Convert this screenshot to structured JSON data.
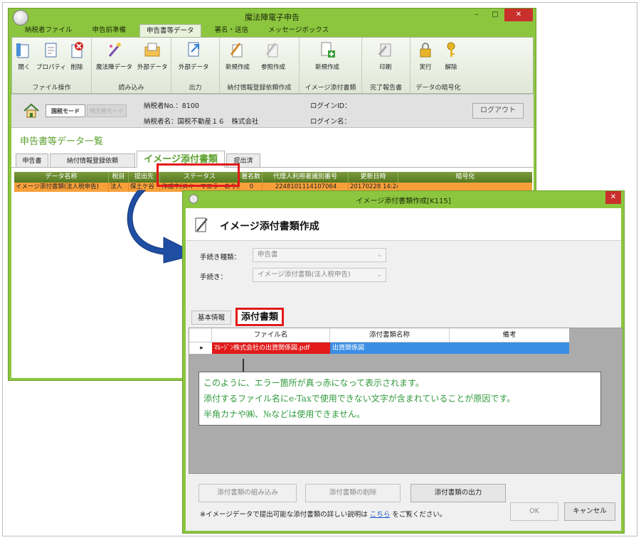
{
  "main_window": {
    "title": "魔法陣電子申告",
    "controls": {
      "minimize": "–",
      "maximize": "□",
      "close": "✕"
    },
    "ribbon_tabs": [
      {
        "label": "納税者ファイル"
      },
      {
        "label": "申告前準備"
      },
      {
        "label": "申告書等データ",
        "active": true
      },
      {
        "label": "署名・送信"
      },
      {
        "label": "メッセージボックス"
      }
    ],
    "ribbon_groups": [
      {
        "label": "ファイル操作",
        "buttons": [
          "開く",
          "プロパティ",
          "削除"
        ]
      },
      {
        "label": "読み込み",
        "buttons": [
          "魔法陣データ",
          "外部データ"
        ]
      },
      {
        "label": "出力",
        "buttons": [
          "外部データ"
        ]
      },
      {
        "label": "納付情報登録依頼作成",
        "buttons": [
          "新規作成",
          "参照作成"
        ]
      },
      {
        "label": "イメージ添付書類",
        "buttons": [
          "新規作成"
        ]
      },
      {
        "label": "完了報告書",
        "buttons": [
          "印刷"
        ]
      },
      {
        "label": "データの暗号化",
        "buttons": [
          "実行",
          "解除"
        ]
      }
    ],
    "mode": {
      "national": "国税モード",
      "local": "地方税モード",
      "taxpayer_no": "納税者No.：8100",
      "taxpayer_name": "納税者名：国税不動産１６　株式会社",
      "login_id": "ログインID：",
      "login_name": "ログイン名：",
      "logout": "ログアウト"
    },
    "section_title": "申告書等データ一覧",
    "tabs": [
      {
        "label": "申告書"
      },
      {
        "label": "納付情報登録依頼"
      },
      {
        "label": "イメージ添付書類",
        "active": true
      },
      {
        "label": "提出済"
      }
    ],
    "grid": {
      "columns": [
        "データ名称",
        "税目",
        "提出先",
        "ステータス",
        "署名数",
        "代理人利用者識別番号",
        "更新日時",
        "暗号化"
      ],
      "rows": [
        [
          "イメージ添付書類(法人税申告)",
          "法人",
          "保土ケ谷",
          "作成中(スキーマエラーあり)",
          "0",
          "2248101114107064",
          "20170228 14:24",
          ""
        ]
      ]
    }
  },
  "dialog": {
    "title": "イメージ添付書類作成[K115]",
    "close": "✕",
    "heading": "イメージ添付書類作成",
    "form": {
      "procedure_type_label": "手続き種類：",
      "procedure_type_value": "申告書",
      "procedure_label": "手続き：",
      "procedure_value": "イメージ添付書類(法人税申告)"
    },
    "tabs": [
      {
        "label": "基本情報"
      },
      {
        "label": "添付書類",
        "active": true
      }
    ],
    "grid": {
      "columns": [
        "ファイル名",
        "添付書類名称",
        "備考"
      ],
      "rows": [
        {
          "marker": "▸",
          "file_name": "ﾏﾙｰｼﾞﾝ株式会社の出資関係図.pdf",
          "doc_name": "出資関係図",
          "note": ""
        }
      ]
    },
    "annotation": [
      "このように、エラー箇所が真っ赤になって表示されます。",
      "添付するファイル名にe-Taxで使用できない文字が含まれていることが原因です。",
      "半角カナや㈱、№などは使用できません。"
    ],
    "buttons": {
      "embed": "添付書類の組み込み",
      "delete": "添付書類の削除",
      "output": "添付書類の出力",
      "ok": "OK",
      "cancel": "キャンセル"
    },
    "footer": {
      "prefix": "※イメージデータで提出可能な添付書類の詳しい説明は",
      "link": "こちら",
      "suffix": "をご覧ください。"
    }
  },
  "colors": {
    "window_frame": "#8cc63f",
    "grid_header": "#557a22",
    "selected_row": "#f7a03a",
    "error_highlight": "#e21a1a",
    "selection_blue": "#3b8ee4",
    "annotation_text": "#2f9a3c",
    "arrow": "#1f4ea3"
  }
}
